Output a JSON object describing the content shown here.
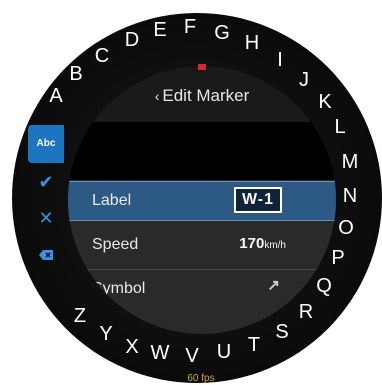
{
  "header": {
    "back_glyph": "‹",
    "title": "Edit Marker"
  },
  "rows": [
    {
      "key": "Label",
      "value": "W-1"
    },
    {
      "key": "Speed",
      "value": "170",
      "unit": "km/h"
    },
    {
      "key": "Symbol",
      "value": ""
    }
  ],
  "side_panel": {
    "abc": "Abc",
    "confirm_icon": "check-icon",
    "cancel_icon": "close-icon",
    "erase_icon": "backspace-icon"
  },
  "ring_letters": [
    "A",
    "B",
    "C",
    "D",
    "E",
    "F",
    "G",
    "H",
    "I",
    "J",
    "K",
    "L",
    "M",
    "N",
    "O",
    "P",
    "Q",
    "R",
    "S",
    "T",
    "U",
    "V",
    "W",
    "X",
    "Y",
    "Z"
  ],
  "footer": {
    "fps": "60 fps"
  },
  "colors": {
    "accent": "#1d74c0",
    "selected_row": "#2c5a85",
    "fps": "#d4a72a",
    "marker": "#d02c2c"
  }
}
